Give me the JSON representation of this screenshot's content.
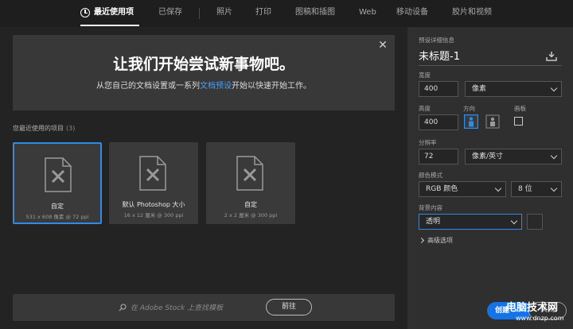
{
  "nav": {
    "tabs": [
      {
        "label": "最近使用项"
      },
      {
        "label": "已保存"
      },
      {
        "label": "照片"
      },
      {
        "label": "打印"
      },
      {
        "label": "图稿和插图"
      },
      {
        "label": "Web"
      },
      {
        "label": "移动设备"
      },
      {
        "label": "胶片和视频"
      }
    ]
  },
  "banner": {
    "title": "让我们开始尝试新事物吧。",
    "sub_before": "从您自己的文档设置或一系列",
    "sub_link": "文档预设",
    "sub_after": "开始以快速开始工作。",
    "close": "✕"
  },
  "recent": {
    "label": "您最近使用的项目",
    "count": "(3)",
    "items": [
      {
        "title": "自定",
        "sub": "531 x 608 像素 @ 72 ppi"
      },
      {
        "title": "默认 Photoshop 大小",
        "sub": "16 x 12 厘米 @ 300 ppi"
      },
      {
        "title": "自定",
        "sub": "2 x 2 厘米 @ 300 ppi"
      }
    ]
  },
  "stock": {
    "placeholder": "在 Adobe Stock 上查找模板",
    "button": "前往"
  },
  "preset": {
    "header": "预设详细信息",
    "title": "未标题-1",
    "width_label": "宽度",
    "width_value": "400",
    "width_unit": "像素",
    "height_label": "高度",
    "height_value": "400",
    "orientation_label": "方向",
    "artboard_label": "画板",
    "resolution_label": "分辨率",
    "resolution_value": "72",
    "resolution_unit": "像素/英寸",
    "color_mode_label": "颜色模式",
    "color_mode": "RGB 颜色",
    "bit_depth": "8 位",
    "background_label": "背景内容",
    "background": "透明",
    "advanced": "高级选项"
  },
  "actions": {
    "create": "创建",
    "close": "关闭"
  },
  "watermark": {
    "big": "电脑技术网",
    "small": "www.dnzp.com"
  },
  "colors": {
    "accent": "#2d8ceb",
    "primary_button": "#1473e6",
    "panel_bg": "#2f2f2f",
    "page_bg": "#232323"
  },
  "icons": {
    "recent": "clock-icon",
    "document": "document-icon",
    "search": "search-icon",
    "save_preset": "save-preset-icon",
    "portrait": "portrait-orientation-icon",
    "landscape": "landscape-orientation-icon"
  }
}
